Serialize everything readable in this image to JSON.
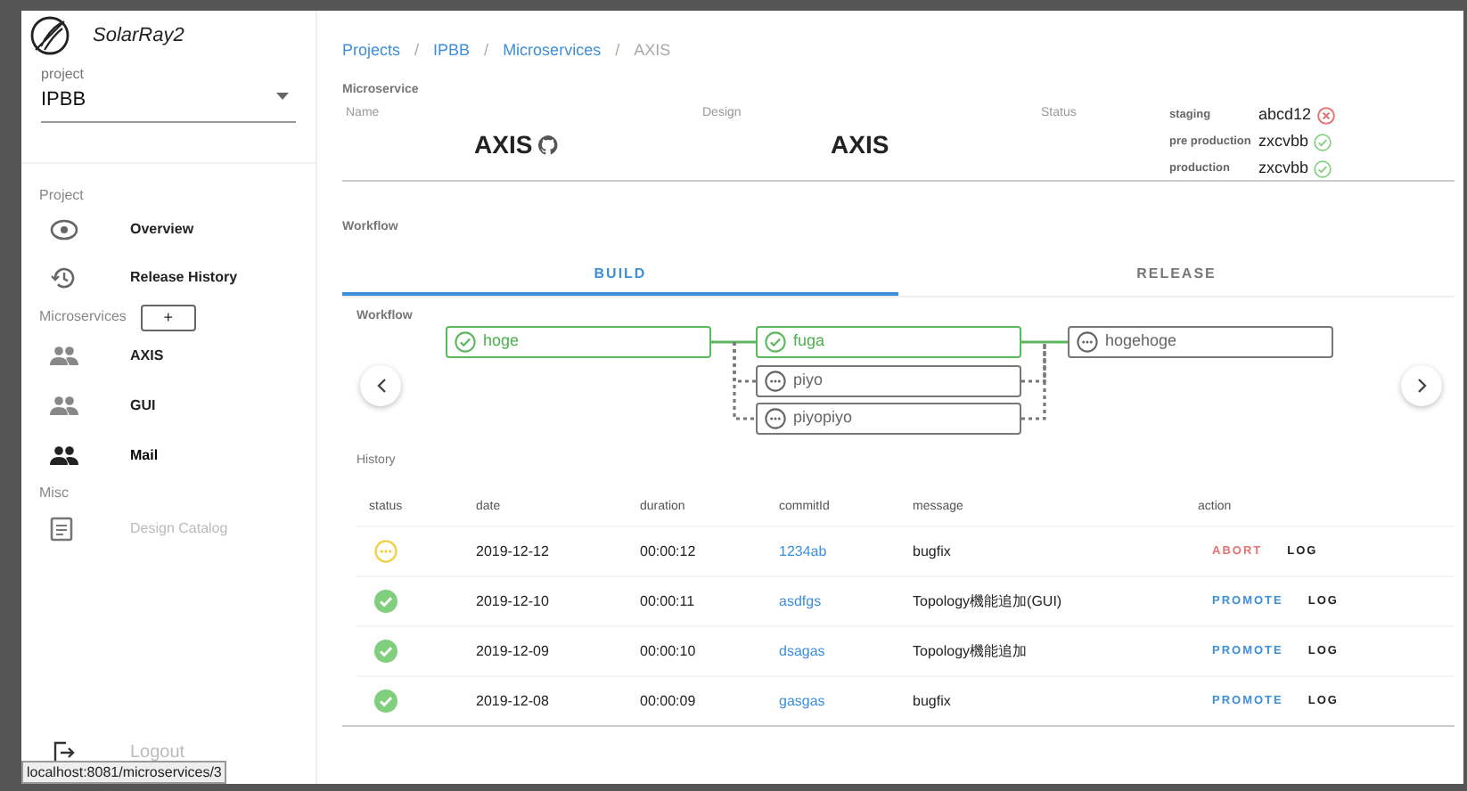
{
  "app": {
    "name": "SolarRay2"
  },
  "project_select": {
    "label": "project",
    "value": "IPBB"
  },
  "sidebar": {
    "project_heading": "Project",
    "project_items": [
      {
        "label": "Overview",
        "disabled": false
      },
      {
        "label": "Release History",
        "disabled": false
      }
    ],
    "microservices_heading": "Microservices",
    "add_button": "+",
    "microservice_items": [
      {
        "label": "AXIS",
        "hovered": false
      },
      {
        "label": "GUI",
        "hovered": false
      },
      {
        "label": "Mail",
        "hovered": true
      }
    ],
    "misc_heading": "Misc",
    "misc_items": [
      {
        "label": "Design Catalog",
        "disabled": true
      }
    ],
    "logout": "Logout"
  },
  "status_url": "localhost:8081/microservices/3",
  "breadcrumbs": [
    {
      "label": "Projects",
      "link": true
    },
    {
      "label": "IPBB",
      "link": true
    },
    {
      "label": "Microservices",
      "link": true
    },
    {
      "label": "AXIS",
      "link": false
    }
  ],
  "breadcrumb_separator": "/",
  "microservice": {
    "heading": "Microservice",
    "name_label": "Name",
    "name": "AXIS",
    "design_label": "Design",
    "design": "AXIS",
    "status_label": "Status",
    "environments": [
      {
        "name": "staging",
        "version": "abcd12",
        "ok": false
      },
      {
        "name": "pre production",
        "version": "zxcvbb",
        "ok": true
      },
      {
        "name": "production",
        "version": "zxcvbb",
        "ok": true
      }
    ]
  },
  "workflow": {
    "heading": "Workflow",
    "tabs": [
      {
        "label": "BUILD",
        "selected": true
      },
      {
        "label": "RELEASE",
        "selected": false
      }
    ],
    "canvas_label": "Workflow",
    "stages": [
      [
        {
          "label": "hoge",
          "done": true
        }
      ],
      [
        {
          "label": "fuga",
          "done": true
        },
        {
          "label": "piyo",
          "done": false
        },
        {
          "label": "piyopiyo",
          "done": false
        }
      ],
      [
        {
          "label": "hogehoge",
          "done": false
        }
      ]
    ]
  },
  "history": {
    "heading": "History",
    "columns": [
      "status",
      "date",
      "duration",
      "commitId",
      "message",
      "action"
    ],
    "rows": [
      {
        "kind": "running",
        "date": "2019-12-12",
        "duration": "00:00:12",
        "commit": "1234ab",
        "message": "bugfix",
        "actions": [
          {
            "label": "ABORT",
            "kind": "abort"
          },
          {
            "label": "LOG",
            "kind": "log"
          }
        ]
      },
      {
        "kind": "success",
        "date": "2019-12-10",
        "duration": "00:00:11",
        "commit": "asdfgs",
        "message": "Topology機能追加(GUI)",
        "actions": [
          {
            "label": "PROMOTE",
            "kind": "promote"
          },
          {
            "label": "LOG",
            "kind": "log"
          }
        ]
      },
      {
        "kind": "success",
        "date": "2019-12-09",
        "duration": "00:00:10",
        "commit": "dsagas",
        "message": "Topology機能追加",
        "actions": [
          {
            "label": "PROMOTE",
            "kind": "promote"
          },
          {
            "label": "LOG",
            "kind": "log"
          }
        ]
      },
      {
        "kind": "success",
        "date": "2019-12-08",
        "duration": "00:00:09",
        "commit": "gasgas",
        "message": "bugfix",
        "actions": [
          {
            "label": "PROMOTE",
            "kind": "promote"
          },
          {
            "label": "LOG",
            "kind": "log"
          }
        ]
      }
    ]
  }
}
